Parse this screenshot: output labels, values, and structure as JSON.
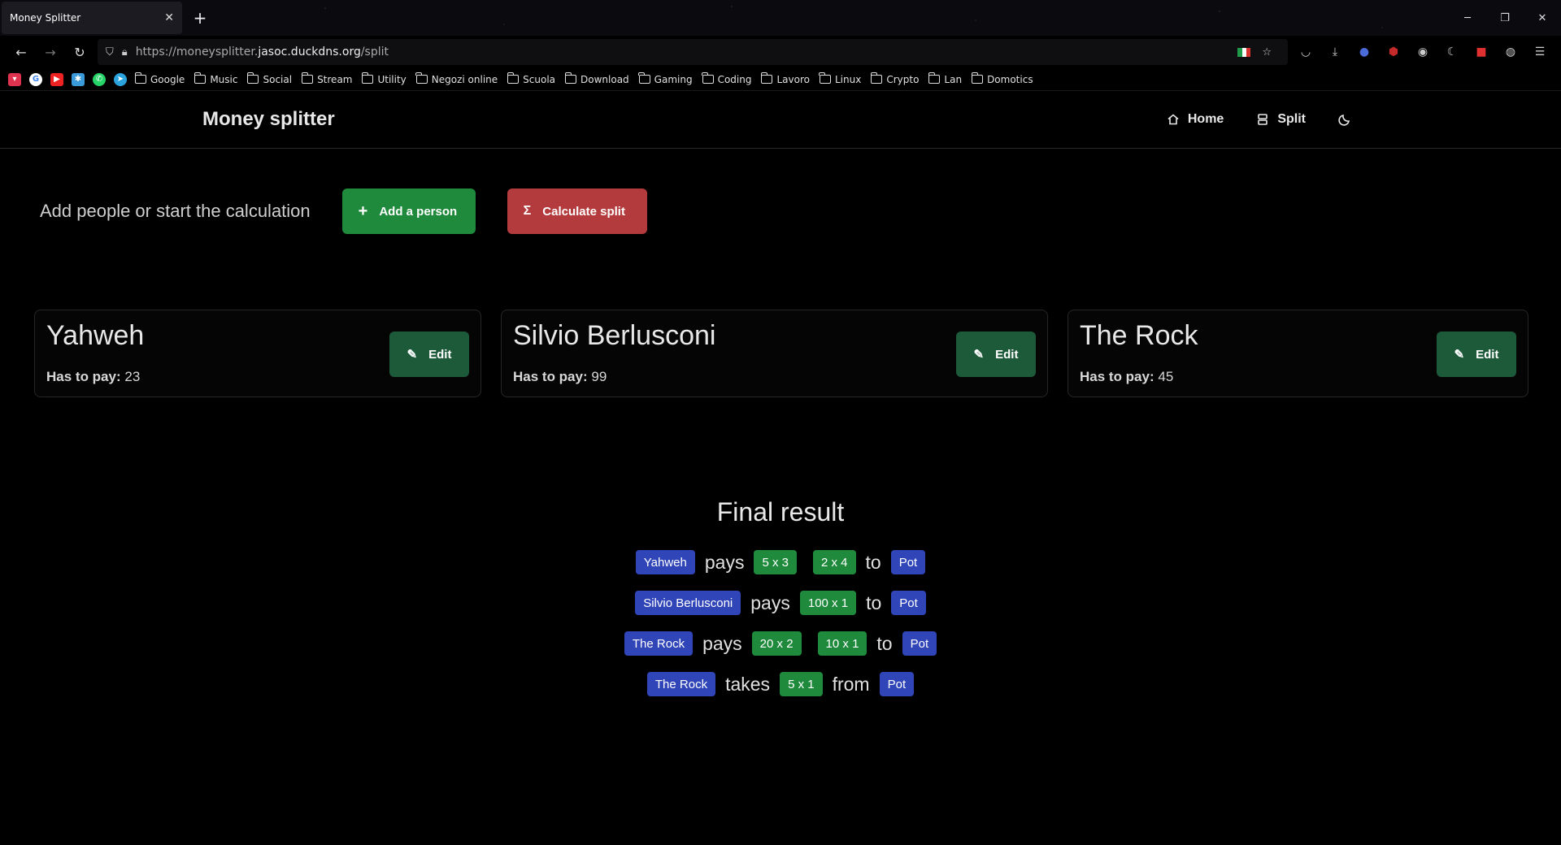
{
  "browser": {
    "tab_title": "Money Splitter",
    "url_prefix": "https://moneysplitter.",
    "url_host": "jasoc.duckdns.org",
    "url_path": "/split",
    "bookmarks": [
      "Google",
      "Music",
      "Social",
      "Stream",
      "Utility",
      "Negozi online",
      "Scuola",
      "Download",
      "Gaming",
      "Coding",
      "Lavoro",
      "Linux",
      "Crypto",
      "Lan",
      "Domotics"
    ]
  },
  "header": {
    "brand": "Money splitter",
    "nav_home": "Home",
    "nav_split": "Split"
  },
  "actions": {
    "prompt": "Add people or start the calculation",
    "add_label": "Add a person",
    "calc_label": "Calculate split"
  },
  "people": [
    {
      "name": "Yahweh",
      "pay_label": "Has to pay:",
      "amount": "23",
      "edit": "Edit"
    },
    {
      "name": "Silvio Berlusconi",
      "pay_label": "Has to pay:",
      "amount": "99",
      "edit": "Edit"
    },
    {
      "name": "The Rock",
      "pay_label": "Has to pay:",
      "amount": "45",
      "edit": "Edit"
    }
  ],
  "result": {
    "title": "Final result",
    "rows": [
      {
        "person": "Yahweh",
        "verb": "pays",
        "items": [
          "5 x 3",
          "2 x 4"
        ],
        "prep": "to",
        "target": "Pot"
      },
      {
        "person": "Silvio Berlusconi",
        "verb": "pays",
        "items": [
          "100 x 1"
        ],
        "prep": "to",
        "target": "Pot"
      },
      {
        "person": "The Rock",
        "verb": "pays",
        "items": [
          "20 x 2",
          "10 x 1"
        ],
        "prep": "to",
        "target": "Pot"
      },
      {
        "person": "The Rock",
        "verb": "takes",
        "items": [
          "5 x 1"
        ],
        "prep": "from",
        "target": "Pot"
      }
    ]
  },
  "colors": {
    "green": "#1f8a3c",
    "red": "#b43b3d",
    "blue_badge": "#2f45b8",
    "edit_green": "#1c5a3a"
  }
}
